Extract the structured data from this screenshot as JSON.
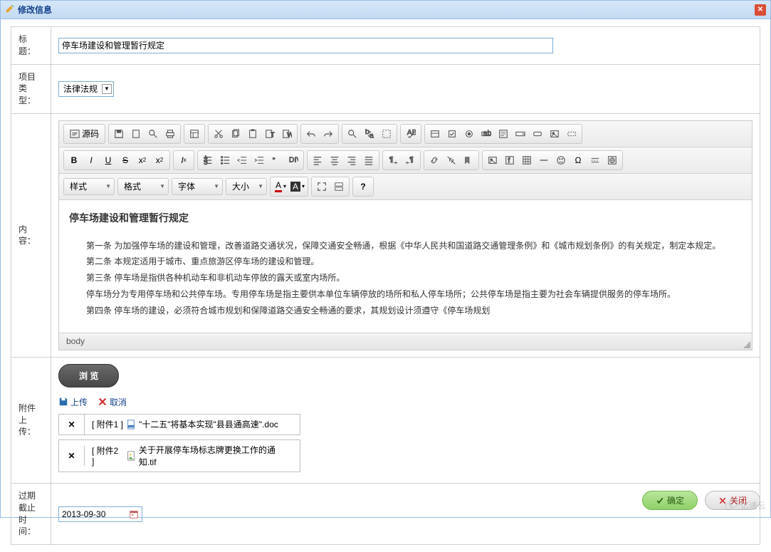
{
  "dialog": {
    "title": "修改信息"
  },
  "form": {
    "title_label": "标题：",
    "title_value": "停车场建设和管理暂行规定",
    "category_label": "项目类型：",
    "category_value": "法律法规",
    "content_label": "内容：",
    "attachments_label": "附件上传：",
    "deadline_label": "过期截止时间：",
    "deadline_value": "2013-09-30"
  },
  "editor": {
    "source_label": "源码",
    "combos": {
      "style": "样式",
      "format": "格式",
      "font": "字体",
      "size": "大小"
    },
    "status": "body",
    "doc_title": "停车场建设和管理暂行规定",
    "paragraphs": [
      "第一条  为加强停车场的建设和管理，改善道路交通状况，保障交通安全畅通，根据《中华人民共和国道路交通管理条例》和《城市规划条例》的有关规定，制定本规定。",
      "第二条  本规定适用于城市、重点旅游区停车场的建设和管理。",
      "第三条  停车场是指供各种机动车和非机动车停放的露天或室内场所。",
      "停车场分为专用停车场和公共停车场。专用停车场是指主要供本单位车辆停放的场所和私人停车场所；公共停车场是指主要为社会车辆提供服务的停车场所。",
      "第四条  停车场的建设，必须符合城市规划和保障道路交通安全畅通的要求，其规划设计须遵守《停车场规划"
    ]
  },
  "attachments": {
    "browse": "浏 览",
    "upload": "上传",
    "cancel": "取消",
    "items": [
      {
        "label": "[ 附件1 ]",
        "filename": "\"十二五\"将基本实现\"县县通高速\".doc"
      },
      {
        "label": "[ 附件2 ]",
        "filename": "关于开展停车场标志牌更换工作的通知.tif"
      }
    ]
  },
  "buttons": {
    "ok": "确定",
    "cancel": "关闭"
  },
  "watermark": "亿速云"
}
